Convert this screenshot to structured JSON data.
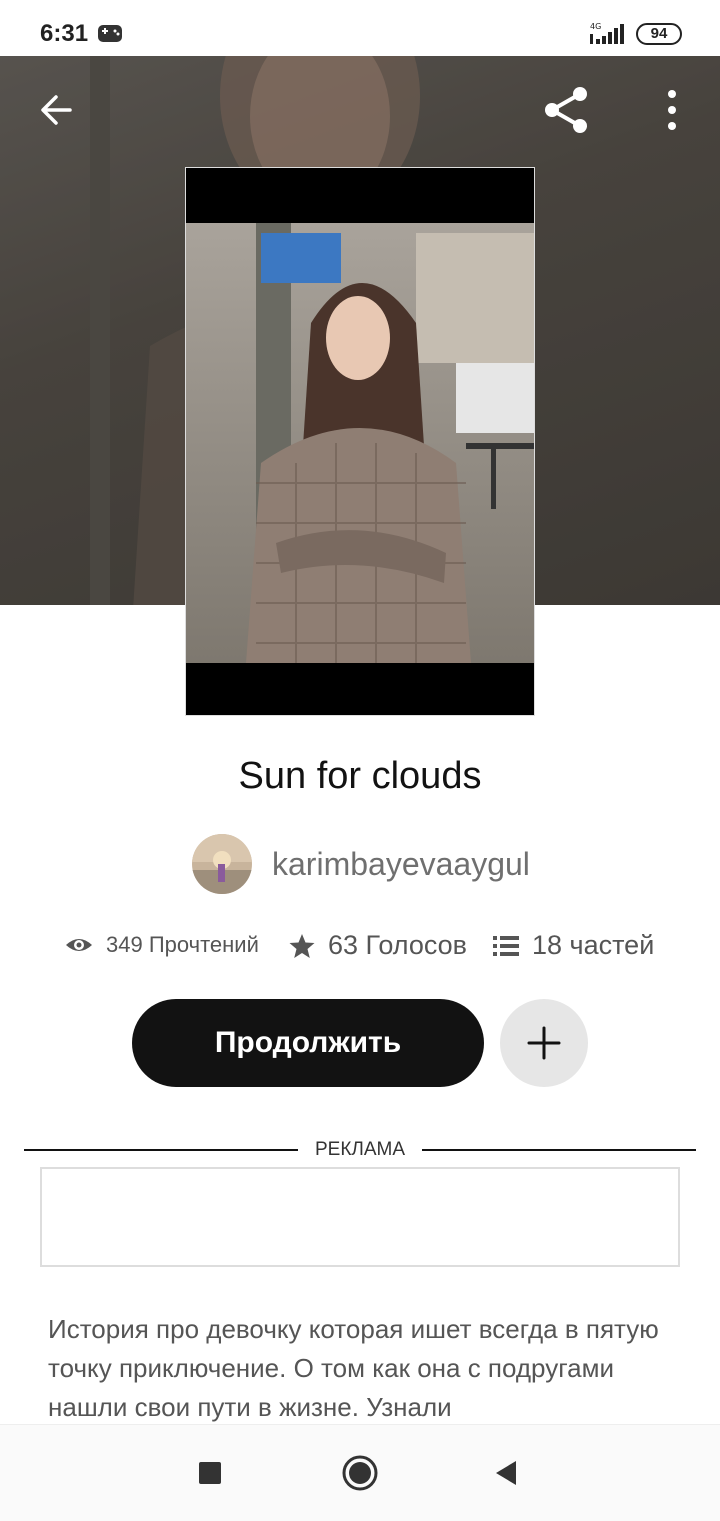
{
  "status_bar": {
    "time": "6:31",
    "network": "4G",
    "battery": "94"
  },
  "story": {
    "title": "Sun for clouds",
    "author": "karimbayevaaygul",
    "stats": {
      "reads": "349 Прочтений",
      "votes": "63 Голосов",
      "parts": "18 частей"
    },
    "continue_label": "Продолжить",
    "description": "История про девочку которая ишет всегда в пятую точку приключение. О том как она с подругами нашли свои пути в жизне. Узнали"
  },
  "ad": {
    "label": "РЕКЛАМА"
  },
  "icons": {
    "back": "arrow-left-icon",
    "share": "share-icon",
    "more": "more-vertical-icon",
    "reads": "eye-icon",
    "votes": "star-icon",
    "parts": "list-icon",
    "add": "plus-icon"
  },
  "colors": {
    "primary_button": "#121212",
    "secondary_button": "#e6e6e6",
    "text_muted": "#6f6f6f"
  }
}
